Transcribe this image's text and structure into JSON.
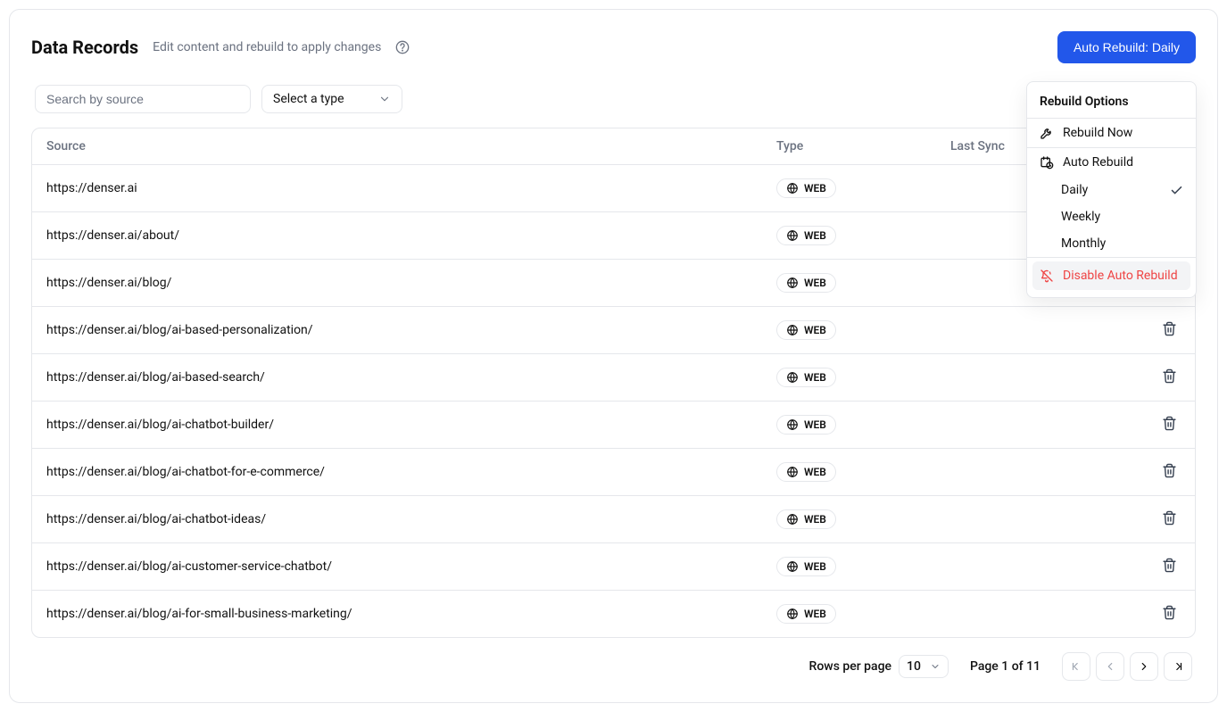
{
  "header": {
    "title": "Data Records",
    "subtitle": "Edit content and rebuild to apply changes",
    "primaryButton": "Auto Rebuild: Daily"
  },
  "controls": {
    "searchPlaceholder": "Search by source",
    "typeSelectLabel": "Select a type"
  },
  "table": {
    "columns": {
      "source": "Source",
      "type": "Type",
      "lastSync": "Last Sync"
    },
    "typeLabel": "WEB",
    "rows": [
      {
        "source": "https://denser.ai",
        "type": "WEB",
        "lastSync": ""
      },
      {
        "source": "https://denser.ai/about/",
        "type": "WEB",
        "lastSync": ""
      },
      {
        "source": "https://denser.ai/blog/",
        "type": "WEB",
        "lastSync": ""
      },
      {
        "source": "https://denser.ai/blog/ai-based-personalization/",
        "type": "WEB",
        "lastSync": ""
      },
      {
        "source": "https://denser.ai/blog/ai-based-search/",
        "type": "WEB",
        "lastSync": ""
      },
      {
        "source": "https://denser.ai/blog/ai-chatbot-builder/",
        "type": "WEB",
        "lastSync": ""
      },
      {
        "source": "https://denser.ai/blog/ai-chatbot-for-e-commerce/",
        "type": "WEB",
        "lastSync": ""
      },
      {
        "source": "https://denser.ai/blog/ai-chatbot-ideas/",
        "type": "WEB",
        "lastSync": ""
      },
      {
        "source": "https://denser.ai/blog/ai-customer-service-chatbot/",
        "type": "WEB",
        "lastSync": ""
      },
      {
        "source": "https://denser.ai/blog/ai-for-small-business-marketing/",
        "type": "WEB",
        "lastSync": ""
      }
    ]
  },
  "pagination": {
    "rowsPerPageLabel": "Rows per page",
    "rowsPerPageValue": "10",
    "pageInfo": "Page 1 of 11"
  },
  "popover": {
    "title": "Rebuild Options",
    "rebuildNow": "Rebuild Now",
    "autoRebuild": "Auto Rebuild",
    "daily": "Daily",
    "weekly": "Weekly",
    "monthly": "Monthly",
    "disable": "Disable Auto Rebuild",
    "selected": "Daily"
  }
}
